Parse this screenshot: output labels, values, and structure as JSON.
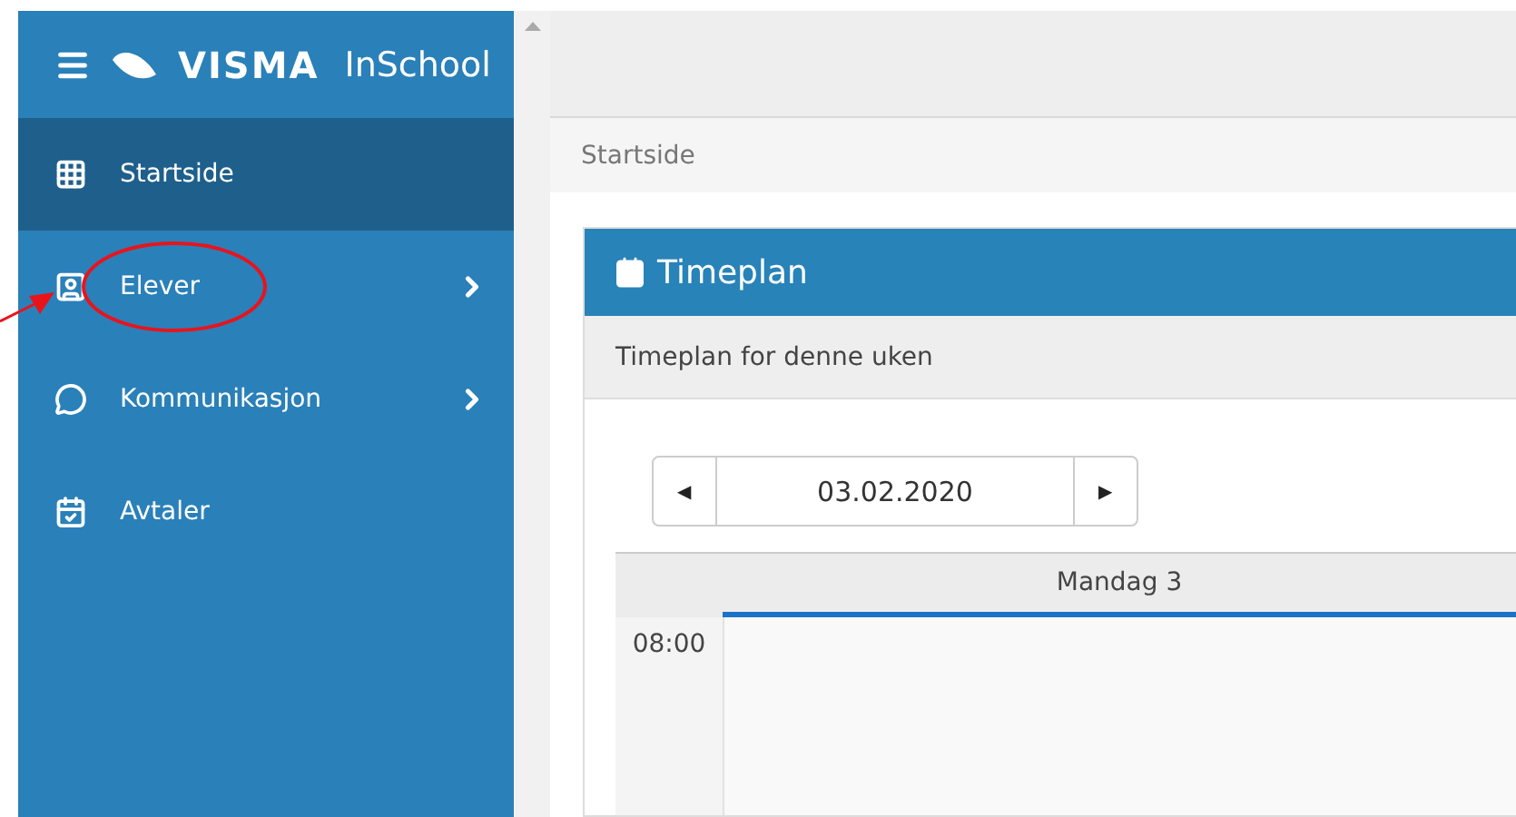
{
  "logo": {
    "brand": "VISMA",
    "product": "InSchool"
  },
  "sidebar": {
    "items": [
      {
        "label": "Startside",
        "kind": "grid",
        "selected": true,
        "has_submenu": false,
        "circled": false
      },
      {
        "label": "Elever",
        "kind": "students",
        "selected": false,
        "has_submenu": true,
        "circled": true
      },
      {
        "label": "Kommunikasjon",
        "kind": "chat",
        "selected": false,
        "has_submenu": true,
        "circled": false
      },
      {
        "label": "Avtaler",
        "kind": "calendar",
        "selected": false,
        "has_submenu": false,
        "circled": false
      }
    ]
  },
  "breadcrumb": "Startside",
  "card": {
    "title": "Timeplan",
    "subtitle": "Timeplan for denne uken",
    "date_picker": {
      "prev": "◀",
      "value": "03.02.2020",
      "next": "▶"
    },
    "calendar": {
      "day": "Mandag 3",
      "times": [
        "08:00"
      ]
    }
  }
}
